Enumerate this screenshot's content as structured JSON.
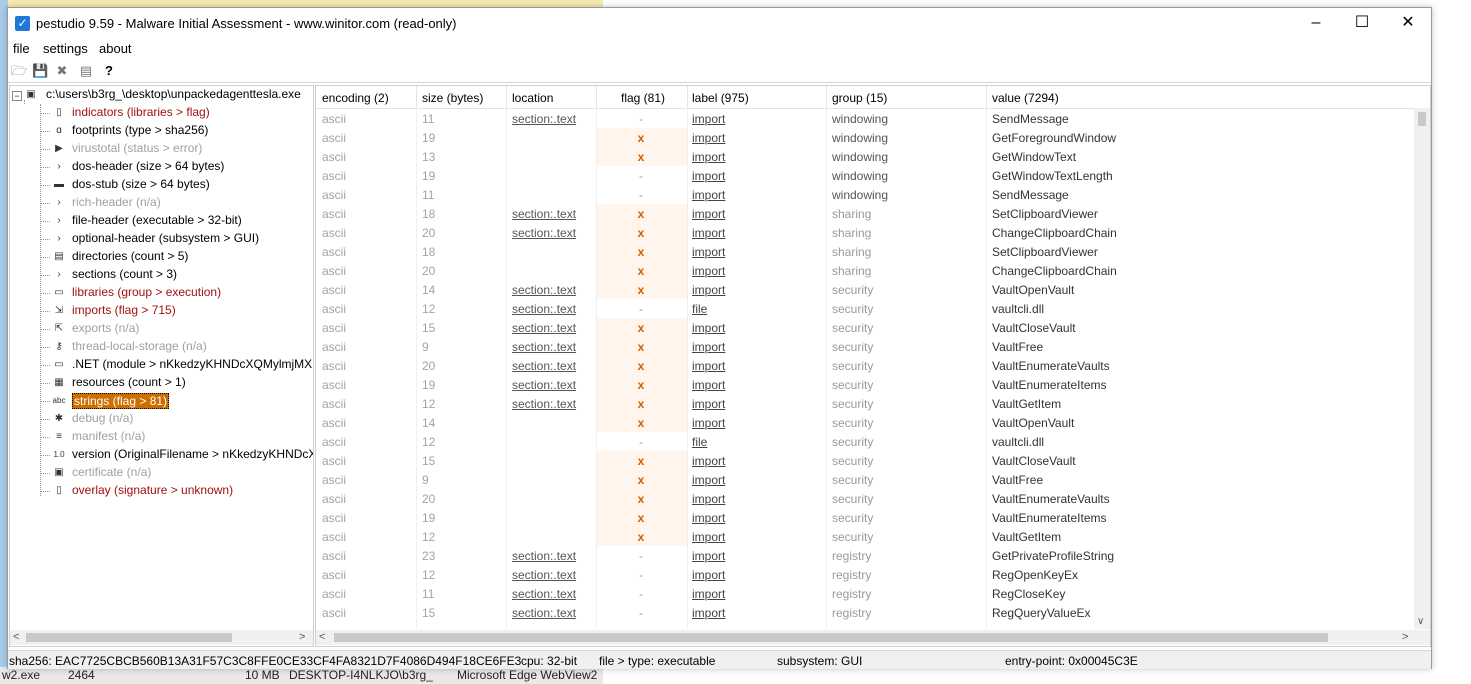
{
  "window": {
    "title": "pestudio 9.59 - Malware Initial Assessment - www.winitor.com (read-only)"
  },
  "menu": [
    "file",
    "settings",
    "about"
  ],
  "background_strip": [
    "w2.exe",
    "2464",
    "10 MB",
    "DESKTOP-I4NLKJO\\b3rg_",
    "Microsoft Edge WebView2"
  ],
  "tree": {
    "root": "c:\\users\\b3rg_\\desktop\\unpackedagenttesla.exe",
    "items": [
      {
        "label": "indicators (libraries > flag)",
        "style": "red",
        "icon": "bars-icon"
      },
      {
        "label": "footprints (type > sha256)",
        "style": "normal",
        "icon": "footprints-icon"
      },
      {
        "label": "virustotal (status > error)",
        "style": "gray",
        "icon": "virustotal-icon"
      },
      {
        "label": "dos-header (size > 64 bytes)",
        "style": "normal",
        "icon": "expand-arrow-icon"
      },
      {
        "label": "dos-stub (size > 64 bytes)",
        "style": "normal",
        "icon": "console-icon"
      },
      {
        "label": "rich-header (n/a)",
        "style": "gray",
        "icon": "expand-arrow-icon"
      },
      {
        "label": "file-header (executable > 32-bit)",
        "style": "normal",
        "icon": "expand-arrow-icon"
      },
      {
        "label": "optional-header (subsystem > GUI)",
        "style": "normal",
        "icon": "expand-arrow-icon"
      },
      {
        "label": "directories (count > 5)",
        "style": "normal",
        "icon": "directories-icon"
      },
      {
        "label": "sections (count > 3)",
        "style": "normal",
        "icon": "expand-arrow-icon"
      },
      {
        "label": "libraries (group > execution)",
        "style": "red",
        "icon": "library-icon"
      },
      {
        "label": "imports (flag > 715)",
        "style": "red",
        "icon": "imports-icon"
      },
      {
        "label": "exports (n/a)",
        "style": "gray",
        "icon": "exports-icon"
      },
      {
        "label": "thread-local-storage (n/a)",
        "style": "gray",
        "icon": "key-icon"
      },
      {
        "label": ".NET (module > nKkedzyKHNDcXQMylmjMX",
        "style": "normal",
        "icon": "dotnet-icon"
      },
      {
        "label": "resources (count > 1)",
        "style": "normal",
        "icon": "resources-icon"
      },
      {
        "label": "strings (flag > 81)",
        "style": "selected",
        "icon": "abc-icon"
      },
      {
        "label": "debug (n/a)",
        "style": "gray",
        "icon": "bug-icon"
      },
      {
        "label": "manifest (n/a)",
        "style": "gray",
        "icon": "manifest-icon"
      },
      {
        "label": "version (OriginalFilename > nKkedzyKHNDcX",
        "style": "normal",
        "icon": "version-icon"
      },
      {
        "label": "certificate (n/a)",
        "style": "gray",
        "icon": "certificate-icon"
      },
      {
        "label": "overlay (signature > unknown)",
        "style": "red",
        "icon": "overlay-icon"
      }
    ]
  },
  "grid": {
    "columns": [
      "encoding (2)",
      "size (bytes)",
      "location",
      "flag (81)",
      "label (975)",
      "group (15)",
      "value (7294)"
    ],
    "rows": [
      [
        "ascii",
        "11",
        "section:.text",
        "-",
        "import",
        "windowing",
        "SendMessage"
      ],
      [
        "ascii",
        "19",
        "",
        "x",
        "import",
        "windowing",
        "GetForegroundWindow"
      ],
      [
        "ascii",
        "13",
        "",
        "x",
        "import",
        "windowing",
        "GetWindowText"
      ],
      [
        "ascii",
        "19",
        "",
        "-",
        "import",
        "windowing",
        "GetWindowTextLength"
      ],
      [
        "ascii",
        "11",
        "",
        "-",
        "import",
        "windowing",
        "SendMessage"
      ],
      [
        "ascii",
        "18",
        "section:.text",
        "x",
        "import",
        "sharing",
        "SetClipboardViewer"
      ],
      [
        "ascii",
        "20",
        "section:.text",
        "x",
        "import",
        "sharing",
        "ChangeClipboardChain"
      ],
      [
        "ascii",
        "18",
        "",
        "x",
        "import",
        "sharing",
        "SetClipboardViewer"
      ],
      [
        "ascii",
        "20",
        "",
        "x",
        "import",
        "sharing",
        "ChangeClipboardChain"
      ],
      [
        "ascii",
        "14",
        "section:.text",
        "x",
        "import",
        "security",
        "VaultOpenVault"
      ],
      [
        "ascii",
        "12",
        "section:.text",
        "-",
        "file",
        "security",
        "vaultcli.dll"
      ],
      [
        "ascii",
        "15",
        "section:.text",
        "x",
        "import",
        "security",
        "VaultCloseVault"
      ],
      [
        "ascii",
        "9",
        "section:.text",
        "x",
        "import",
        "security",
        "VaultFree"
      ],
      [
        "ascii",
        "20",
        "section:.text",
        "x",
        "import",
        "security",
        "VaultEnumerateVaults"
      ],
      [
        "ascii",
        "19",
        "section:.text",
        "x",
        "import",
        "security",
        "VaultEnumerateItems"
      ],
      [
        "ascii",
        "12",
        "section:.text",
        "x",
        "import",
        "security",
        "VaultGetItem"
      ],
      [
        "ascii",
        "14",
        "",
        "x",
        "import",
        "security",
        "VaultOpenVault"
      ],
      [
        "ascii",
        "12",
        "",
        "-",
        "file",
        "security",
        "vaultcli.dll"
      ],
      [
        "ascii",
        "15",
        "",
        "x",
        "import",
        "security",
        "VaultCloseVault"
      ],
      [
        "ascii",
        "9",
        "",
        "x",
        "import",
        "security",
        "VaultFree"
      ],
      [
        "ascii",
        "20",
        "",
        "x",
        "import",
        "security",
        "VaultEnumerateVaults"
      ],
      [
        "ascii",
        "19",
        "",
        "x",
        "import",
        "security",
        "VaultEnumerateItems"
      ],
      [
        "ascii",
        "12",
        "",
        "x",
        "import",
        "security",
        "VaultGetItem"
      ],
      [
        "ascii",
        "23",
        "section:.text",
        "-",
        "import",
        "registry",
        "GetPrivateProfileString"
      ],
      [
        "ascii",
        "12",
        "section:.text",
        "-",
        "import",
        "registry",
        "RegOpenKeyEx"
      ],
      [
        "ascii",
        "11",
        "section:.text",
        "-",
        "import",
        "registry",
        "RegCloseKey"
      ],
      [
        "ascii",
        "15",
        "section:.text",
        "-",
        "import",
        "registry",
        "RegQueryValueEx"
      ]
    ]
  },
  "status": {
    "sha256": "sha256: EAC7725CBCB560B13A31F57C3C8FFE0CE33CF4FA8321D7F4086D494F18CE6FE3",
    "cpu": "cpu: 32-bit",
    "file": "file > type: executable",
    "subsystem": "subsystem: GUI",
    "entry": "entry-point: 0x00045C3E"
  }
}
